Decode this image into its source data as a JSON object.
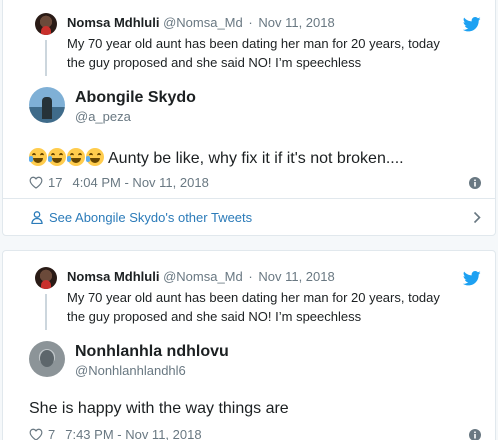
{
  "tweets": [
    {
      "parent": {
        "name": "Nomsa Mdhluli",
        "handle": "@Nomsa_Md",
        "separator": "·",
        "date": "Nov 11, 2018",
        "text": "My 70 year old aunt has been dating her man for 20 years, today the guy proposed and she said NO! I’m speechless"
      },
      "reply": {
        "name": "Abongile Skydo",
        "handle": "@a_peza",
        "emoji": [
          "face-with-tears-of-joy",
          "face-with-tears-of-joy",
          "face-with-tears-of-joy",
          "face-with-tears-of-joy"
        ],
        "text": "Aunty be like, why fix it if it's not broken....",
        "likes": "17",
        "timestamp": "4:04 PM - Nov 11, 2018"
      },
      "footer_link": "See Abongile Skydo's other Tweets"
    },
    {
      "parent": {
        "name": "Nomsa Mdhluli",
        "handle": "@Nomsa_Md",
        "separator": "·",
        "date": "Nov 11, 2018",
        "text": "My 70 year old aunt has been dating her man for 20 years, today the guy proposed and she said NO! I’m speechless"
      },
      "reply": {
        "name": "Nonhlanhla ndhlovu",
        "handle": "@Nonhlanhlandhl6",
        "text": "She is happy with the way things are",
        "likes": "7",
        "timestamp": "7:43 PM - Nov 11, 2018"
      }
    }
  ],
  "colors": {
    "twitter_blue": "#1da1f2",
    "link_blue": "#2b7bb9",
    "muted": "#697882",
    "border": "#e1e8ed"
  }
}
